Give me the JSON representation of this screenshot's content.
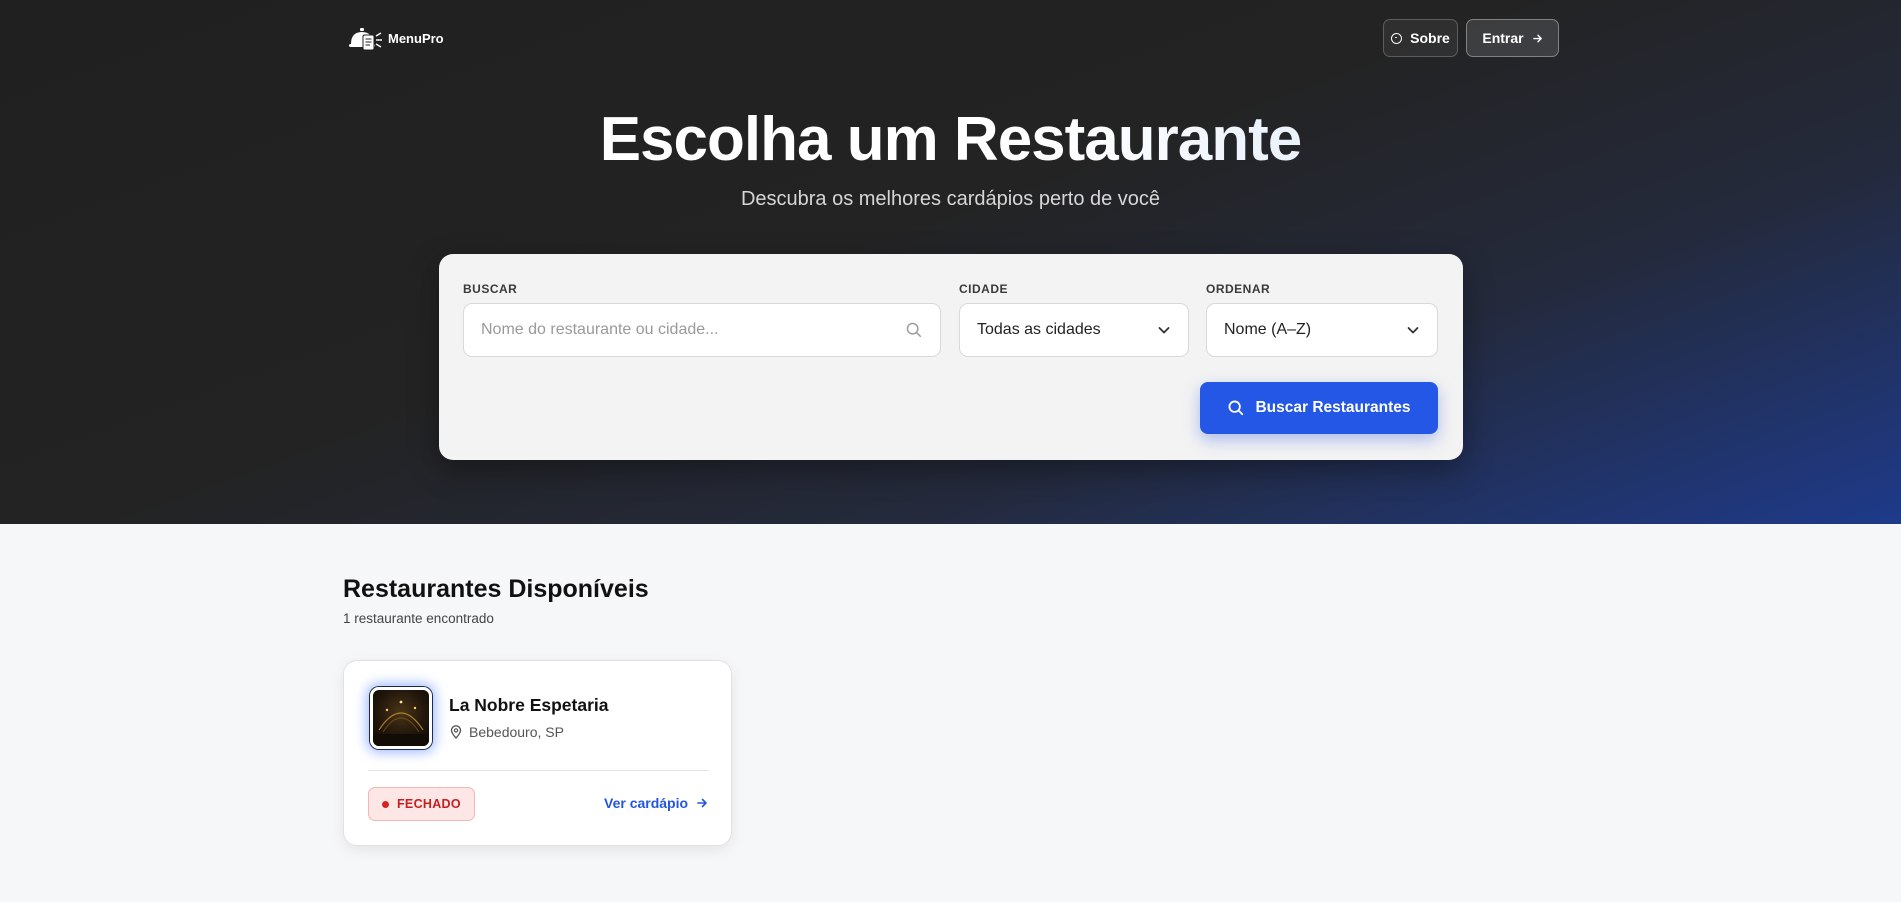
{
  "header": {
    "logo_text": "MenuPro",
    "nav": {
      "about_label": "Sobre",
      "login_label": "Entrar"
    }
  },
  "hero": {
    "title": "Escolha um Restaurante",
    "subtitle": "Descubra os melhores cardápios perto de você"
  },
  "search": {
    "search_label": "BUSCAR",
    "search_placeholder": "Nome do restaurante ou cidade...",
    "search_value": "",
    "city_label": "CIDADE",
    "city_value": "Todas as cidades",
    "order_label": "ORDENAR",
    "order_value": "Nome (A–Z)",
    "submit_label": "Buscar Restaurantes"
  },
  "results": {
    "title": "Restaurantes Disponíveis",
    "count_text": "1 restaurante encontrado",
    "items": [
      {
        "name": "La Nobre Espetaria",
        "location": "Bebedouro, SP",
        "status": "FECHADO",
        "link_label": "Ver cardápio"
      }
    ]
  },
  "colors": {
    "accent": "#2457e6",
    "status_closed": "#c42020",
    "hero_dark": "#202020",
    "hero_blue": "#1e3a8a"
  },
  "icons": [
    "menu-logo-icon",
    "info-icon",
    "arrow-right-icon",
    "search-icon",
    "chevron-down-icon",
    "map-pin-icon"
  ]
}
